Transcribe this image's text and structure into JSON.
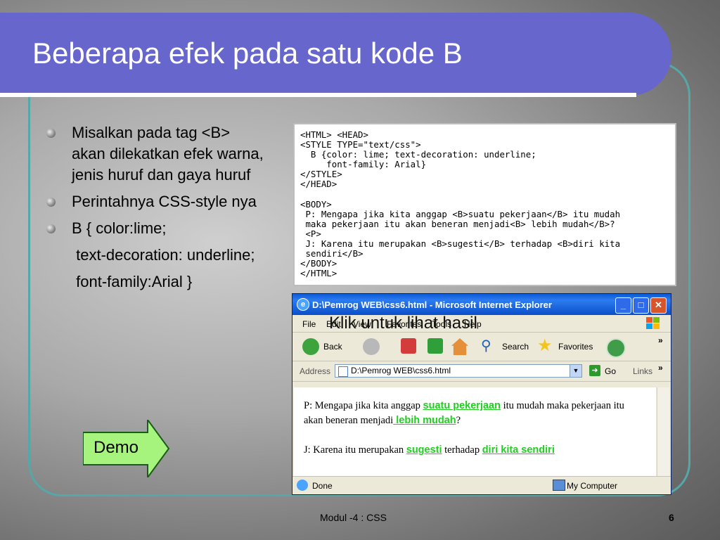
{
  "slide": {
    "title": "Beberapa efek pada satu kode B",
    "bullets": [
      "Misalkan pada tag <B> akan dilekatkan efek warna, jenis huruf dan gaya huruf",
      "Perintahnya CSS-style nya",
      "B { color:lime;"
    ],
    "continuations": [
      " text-decoration: underline;",
      " font-family:Arial }"
    ],
    "demo_label": "Demo",
    "footer": "Modul -4 : CSS",
    "page_number": "6",
    "colors": {
      "title_band": "#6666cc",
      "frame": "#55a8a8",
      "demo_green": "#a6f37e",
      "lime": "#1fce1f"
    }
  },
  "code_panel": {
    "lines": [
      "<HTML> <HEAD>",
      "<STYLE TYPE=\"text/css\">",
      "  B {color: lime; text-decoration: underline;",
      "     font-family: Arial}",
      "</STYLE>",
      "</HEAD>",
      "",
      "<BODY>",
      " P: Mengapa jika kita anggap <B>suatu pekerjaan</B> itu mudah",
      " maka pekerjaan itu akan beneran menjadi<B> lebih mudah</B>?",
      " <P>",
      " J: Karena itu merupakan <B>sugesti</B> terhadap <B>diri kita",
      " sendiri</B>",
      "</BODY>",
      "</HTML>"
    ]
  },
  "browser": {
    "window_title": "D:\\Pemrog WEB\\css6.html - Microsoft Internet Explorer",
    "menu": [
      "File",
      "Edit",
      "View",
      "Favorites",
      "Tools",
      "Help"
    ],
    "overlay_text": "Klik untuk lihat hasil",
    "toolbar": {
      "back": "Back",
      "search": "Search",
      "favorites": "Favorites"
    },
    "address_label": "Address",
    "address_value": "D:\\Pemrog WEB\\css6.html",
    "go_label": "Go",
    "links_label": "Links",
    "content": {
      "p1_a": "P: Mengapa jika kita anggap ",
      "p1_b1": "suatu pekerjaan",
      "p1_c": " itu mudah maka pekerjaan itu akan beneran menjadi",
      "p1_b2": " lebih mudah",
      "p1_d": "?",
      "p2_a": "J: Karena itu merupakan ",
      "p2_b1": "sugesti",
      "p2_c": " terhadap ",
      "p2_b2": "diri kita sendiri"
    },
    "status_left": "Done",
    "status_right": "My Computer",
    "icons": [
      "ie-logo-icon",
      "minimize-icon",
      "maximize-icon",
      "close-icon",
      "back-icon",
      "forward-icon",
      "stop-icon",
      "refresh-icon",
      "home-icon",
      "search-icon",
      "favorites-star-icon",
      "history-icon",
      "windows-logo-icon",
      "page-icon",
      "go-arrow-icon",
      "chevron-icon",
      "computer-icon"
    ]
  }
}
